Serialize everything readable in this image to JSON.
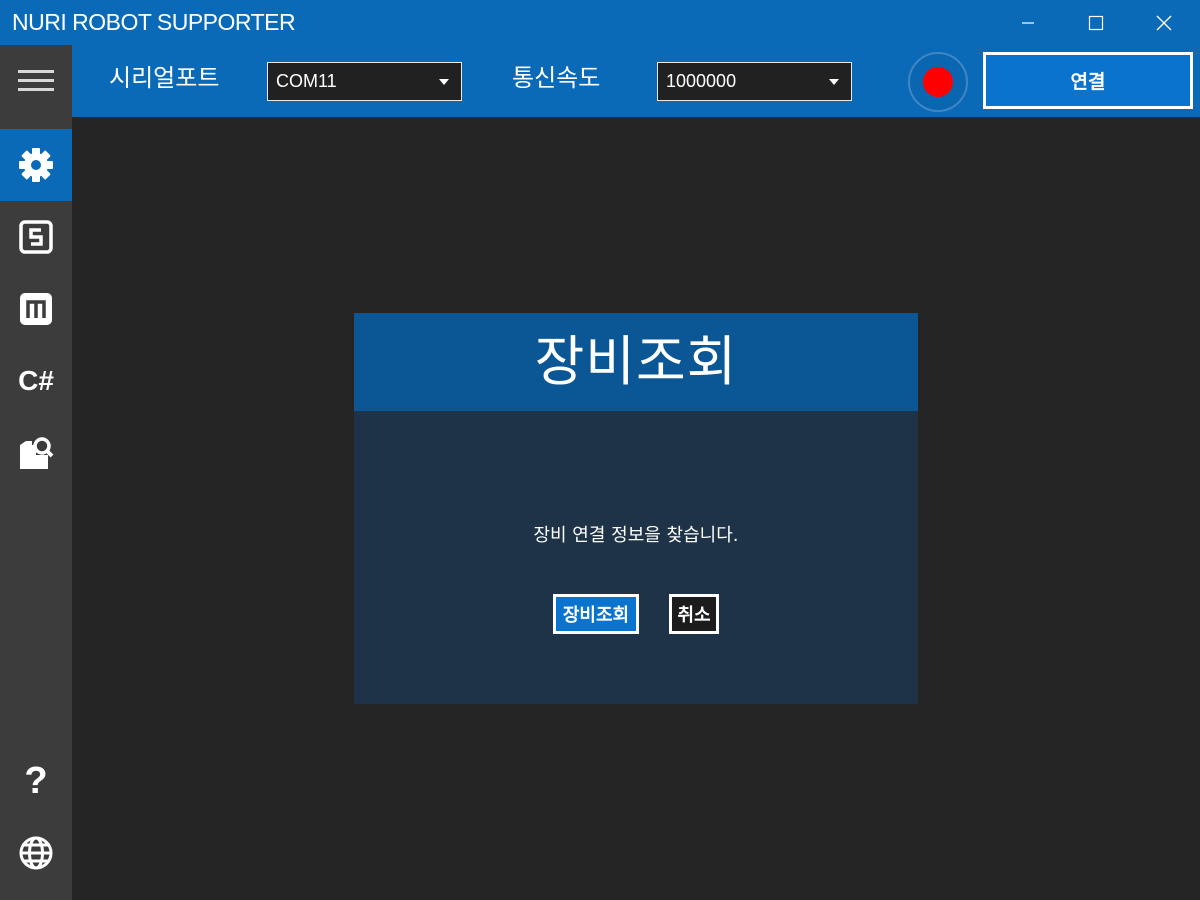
{
  "window": {
    "title": "NURI ROBOT SUPPORTER",
    "controls": [
      "minimize-icon",
      "maximize-icon",
      "close-icon"
    ]
  },
  "sidebar": {
    "items": [
      {
        "icon": "menu-icon",
        "active": false
      },
      {
        "icon": "gear-icon",
        "active": true
      },
      {
        "icon": "s-box-icon",
        "active": false
      },
      {
        "icon": "m-box-icon",
        "active": false
      },
      {
        "icon": "csharp-icon",
        "label": "C#",
        "active": false
      },
      {
        "icon": "folder-search-icon",
        "active": false
      },
      {
        "icon": "help-icon",
        "label": "?",
        "active": false
      },
      {
        "icon": "globe-icon",
        "active": false
      }
    ]
  },
  "toolbar": {
    "serial_port_label": "시리얼포트",
    "serial_port_value": "COM11",
    "baud_rate_label": "통신속도",
    "baud_rate_value": "1000000",
    "status_color": "#ff0000",
    "connect_label": "연결"
  },
  "dialog": {
    "title": "장비조회",
    "message": "장비 연결 정보을 찾습니다.",
    "ok_label": "장비조회",
    "cancel_label": "취소"
  },
  "colors": {
    "accent": "#0a6ab8",
    "sidebar_bg": "#3c3c3c",
    "main_bg": "#252525",
    "dialog_header": "#0b5795",
    "dialog_body": "#1e3348"
  }
}
